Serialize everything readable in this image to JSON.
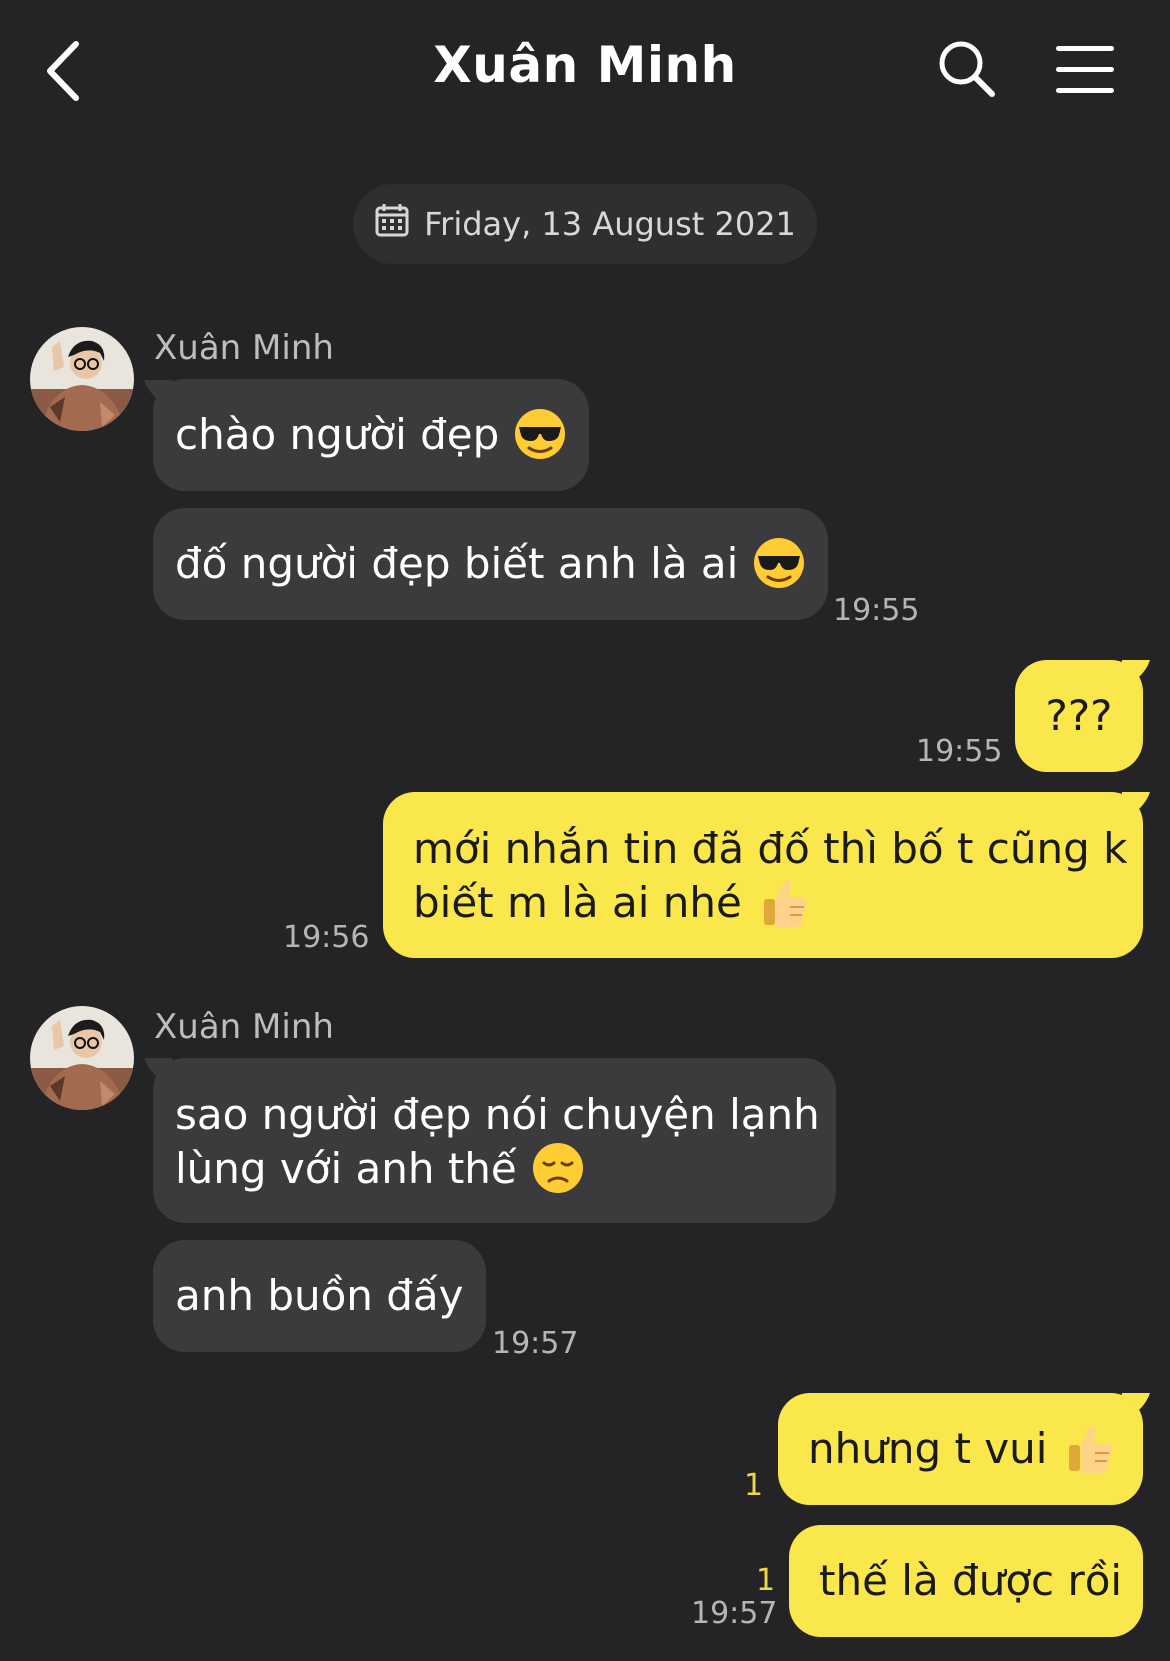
{
  "header": {
    "title": "Xuân Minh",
    "back_icon": "chevron-left-icon",
    "search_icon": "search-icon",
    "menu_icon": "hamburger-menu-icon"
  },
  "date_divider": {
    "icon": "calendar-icon",
    "label": "Friday, 13 August 2021"
  },
  "colors": {
    "background": "#242426",
    "incoming_bubble": "#3b3b3e",
    "outgoing_bubble": "#fae74b",
    "unread_count": "#f2d64a"
  },
  "messages": [
    {
      "direction": "in",
      "sender": "Xuân Minh",
      "text": "chào người đẹp",
      "emoji": "sunglasses-emoji"
    },
    {
      "direction": "in",
      "text": "đố người đẹp biết anh là ai",
      "emoji": "sunglasses-emoji",
      "time": "19:55"
    },
    {
      "direction": "out",
      "text": "???",
      "time": "19:55"
    },
    {
      "direction": "out",
      "lines": [
        "mới nhắn tin đã đố thì bố t cũng k",
        "biết m là ai nhé"
      ],
      "emoji": "thumbs-up-emoji",
      "time": "19:56"
    },
    {
      "direction": "in",
      "sender": "Xuân Minh",
      "lines": [
        "sao người đẹp nói chuyện lạnh",
        "lùng với anh thế"
      ],
      "emoji": "disappointed-face-emoji"
    },
    {
      "direction": "in",
      "text": "anh buồn đấy",
      "time": "19:57"
    },
    {
      "direction": "out",
      "text": "nhưng t vui",
      "emoji": "thumbs-up-emoji",
      "unread": "1"
    },
    {
      "direction": "out",
      "text": "thế là được rồi",
      "unread": "1",
      "time": "19:57"
    }
  ]
}
